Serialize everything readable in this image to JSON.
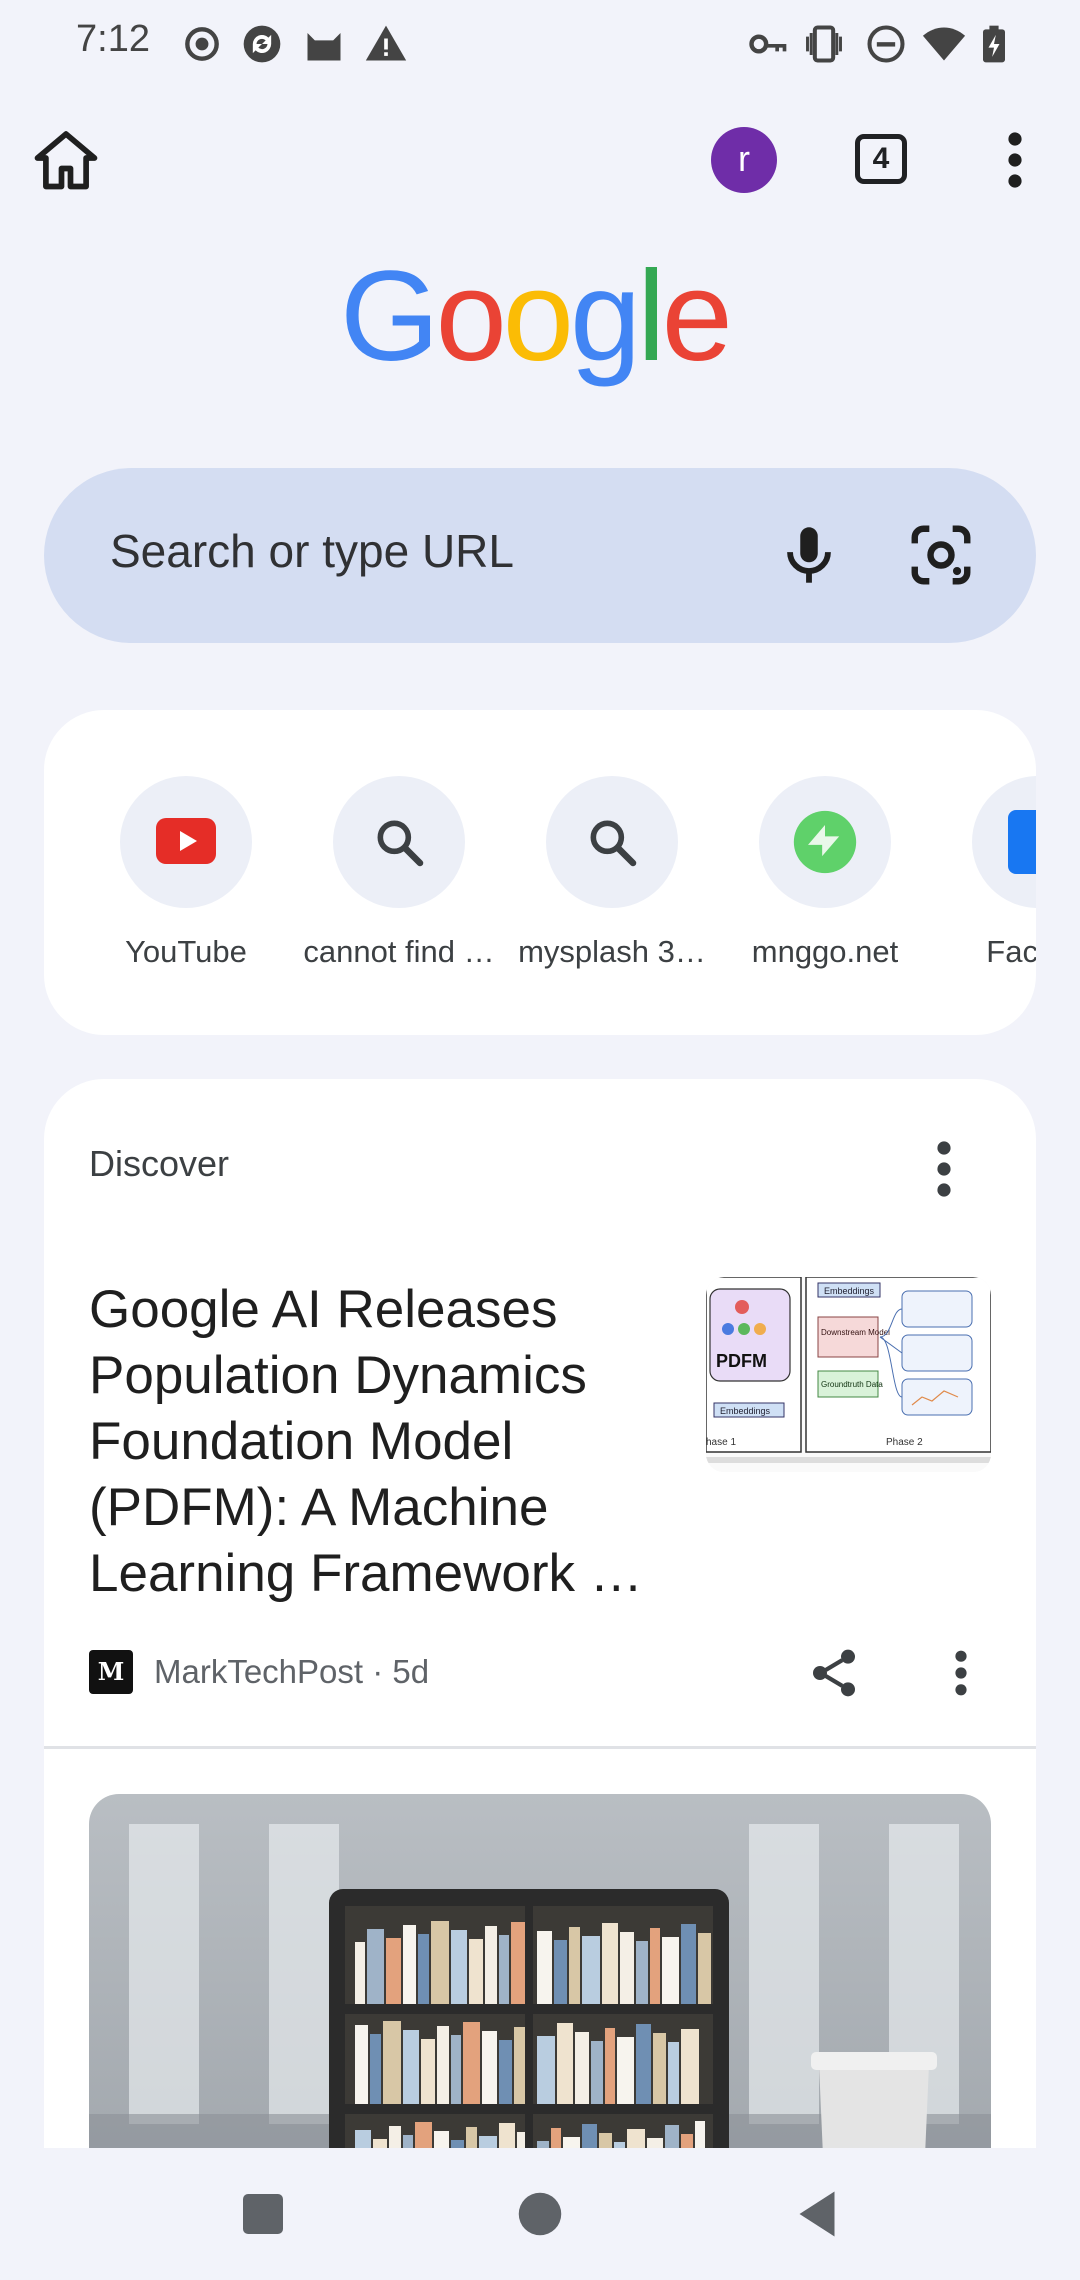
{
  "status_bar": {
    "time": "7:12",
    "left_icons": [
      "record-icon",
      "sync-icon",
      "cat-icon",
      "warning-icon"
    ],
    "right_icons": [
      "vpn-key-icon",
      "vibrate-icon",
      "do-not-disturb-icon",
      "wifi-icon",
      "battery-charging-icon"
    ]
  },
  "toolbar": {
    "avatar_letter": "r",
    "tab_count": "4"
  },
  "search": {
    "placeholder": "Search or type URL"
  },
  "shortcuts": [
    {
      "label": "YouTube",
      "icon": "youtube-icon"
    },
    {
      "label": "cannot find …",
      "icon": "search-icon"
    },
    {
      "label": "mysplash 3…",
      "icon": "search-icon"
    },
    {
      "label": "mnggo.net",
      "icon": "mnggo-icon"
    },
    {
      "label": "Facebo",
      "icon": "facebook-icon"
    }
  ],
  "discover": {
    "title": "Discover",
    "article": {
      "headline": "Google AI Releases Population Dynamics Foundation Model (PDFM): A Machine Learning Framework …",
      "source": "MarkTechPost · 5d",
      "source_logo": "M",
      "thumb_labels": {
        "pdfm": "PDFM",
        "embeddings_top": "Embeddings",
        "embeddings_bottom": "Embeddings",
        "downstream": "Downstream Model",
        "groundtruth": "Groundtruth Data",
        "phase1": "hase 1",
        "phase2": "Phase 2"
      }
    }
  },
  "colors": {
    "background": "#f2f3fa",
    "search_bg": "#d4ddf2",
    "avatar": "#6f2da8"
  }
}
